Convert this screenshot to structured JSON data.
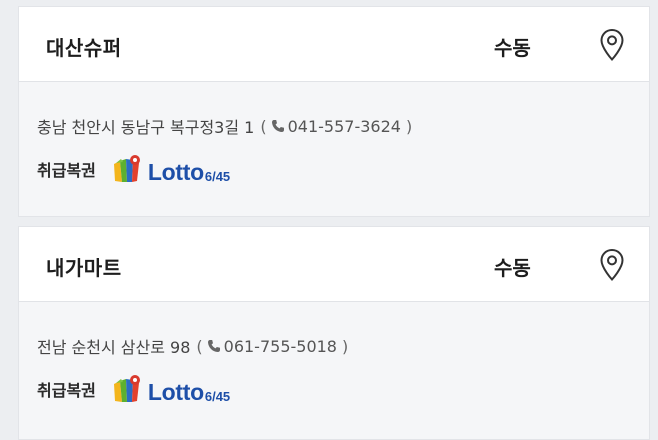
{
  "stores": [
    {
      "name": "대산슈퍼",
      "sale_type": "수동",
      "address": "충남 천안시 동남구 복구정3길 1",
      "phone": "041-557-3624",
      "products_label": "취급복권",
      "product_logo": {
        "word": "Lotto",
        "sub": "6/45"
      }
    },
    {
      "name": "내가마트",
      "sale_type": "수동",
      "address": "전남 순천시 삼산로 98",
      "phone": "061-755-5018",
      "products_label": "취급복권",
      "product_logo": {
        "word": "Lotto",
        "sub": "6/45"
      }
    }
  ],
  "punctuation": {
    "open": "(",
    "close": ")"
  },
  "icons": {
    "map": "map-pin-icon",
    "phone": "phone-icon",
    "lotto": "lotto-balls-icon"
  },
  "colors": {
    "lotto_blue": "#1e4fa8",
    "text": "#1d1d1d",
    "card_bg": "#f5f6f8",
    "header_bg": "#ffffff"
  }
}
